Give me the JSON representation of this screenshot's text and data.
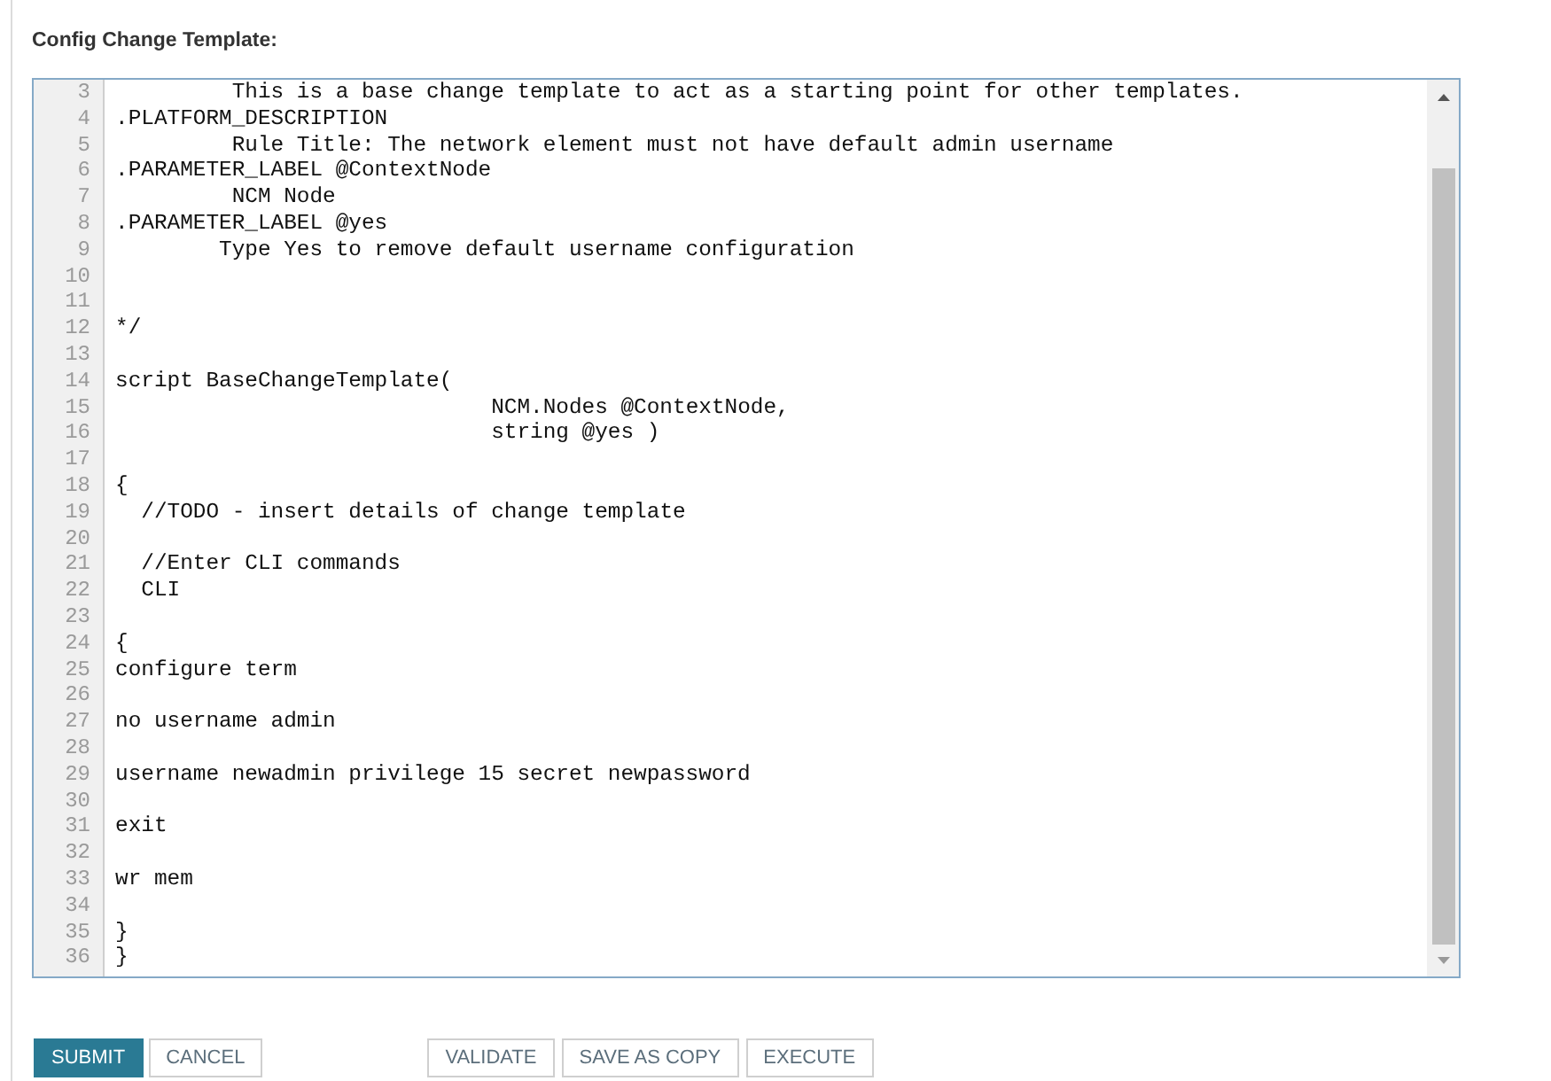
{
  "form": {
    "label": "Config Change Template:"
  },
  "editor": {
    "lines": [
      {
        "number": "3",
        "text": "         This is a base change template to act as a starting point for other templates."
      },
      {
        "number": "4",
        "text": ".PLATFORM_DESCRIPTION"
      },
      {
        "number": "5",
        "text": "         Rule Title: The network element must not have default admin username"
      },
      {
        "number": "6",
        "text": ".PARAMETER_LABEL @ContextNode"
      },
      {
        "number": "7",
        "text": "         NCM Node"
      },
      {
        "number": "8",
        "text": ".PARAMETER_LABEL @yes"
      },
      {
        "number": "9",
        "text": "        Type Yes to remove default username configuration"
      },
      {
        "number": "10"
      },
      {
        "number": "11"
      },
      {
        "number": "12",
        "text": "*/"
      },
      {
        "number": "13"
      },
      {
        "number": "14",
        "text": "script BaseChangeTemplate("
      },
      {
        "number": "15",
        "text": "                             NCM.Nodes @ContextNode,"
      },
      {
        "number": "16",
        "text": "                             string @yes )"
      },
      {
        "number": "17"
      },
      {
        "number": "18",
        "text": "{"
      },
      {
        "number": "19",
        "text": "  //TODO - insert details of change template"
      },
      {
        "number": "20"
      },
      {
        "number": "21",
        "text": "  //Enter CLI commands"
      },
      {
        "number": "22",
        "text": "  CLI"
      },
      {
        "number": "23"
      },
      {
        "number": "24",
        "text": "{"
      },
      {
        "number": "25",
        "text": "configure term"
      },
      {
        "number": "26"
      },
      {
        "number": "27",
        "text": "no username admin"
      },
      {
        "number": "28"
      },
      {
        "number": "29",
        "text": "username newadmin privilege 15 secret newpassword"
      },
      {
        "number": "30"
      },
      {
        "number": "31",
        "text": "exit"
      },
      {
        "number": "32"
      },
      {
        "number": "33",
        "text": "wr mem"
      },
      {
        "number": "34"
      },
      {
        "number": "35",
        "text": "}"
      },
      {
        "number": "36",
        "text": "}"
      }
    ]
  },
  "footer": {
    "left_buttons": [
      {
        "label": "SUBMIT",
        "kind": "primary"
      },
      {
        "label": "CANCEL",
        "kind": "secondary"
      }
    ],
    "right_buttons": [
      {
        "label": "VALIDATE",
        "kind": "secondary"
      },
      {
        "label": "SAVE AS COPY",
        "kind": "secondary"
      },
      {
        "label": "EXECUTE",
        "kind": "secondary"
      }
    ]
  }
}
